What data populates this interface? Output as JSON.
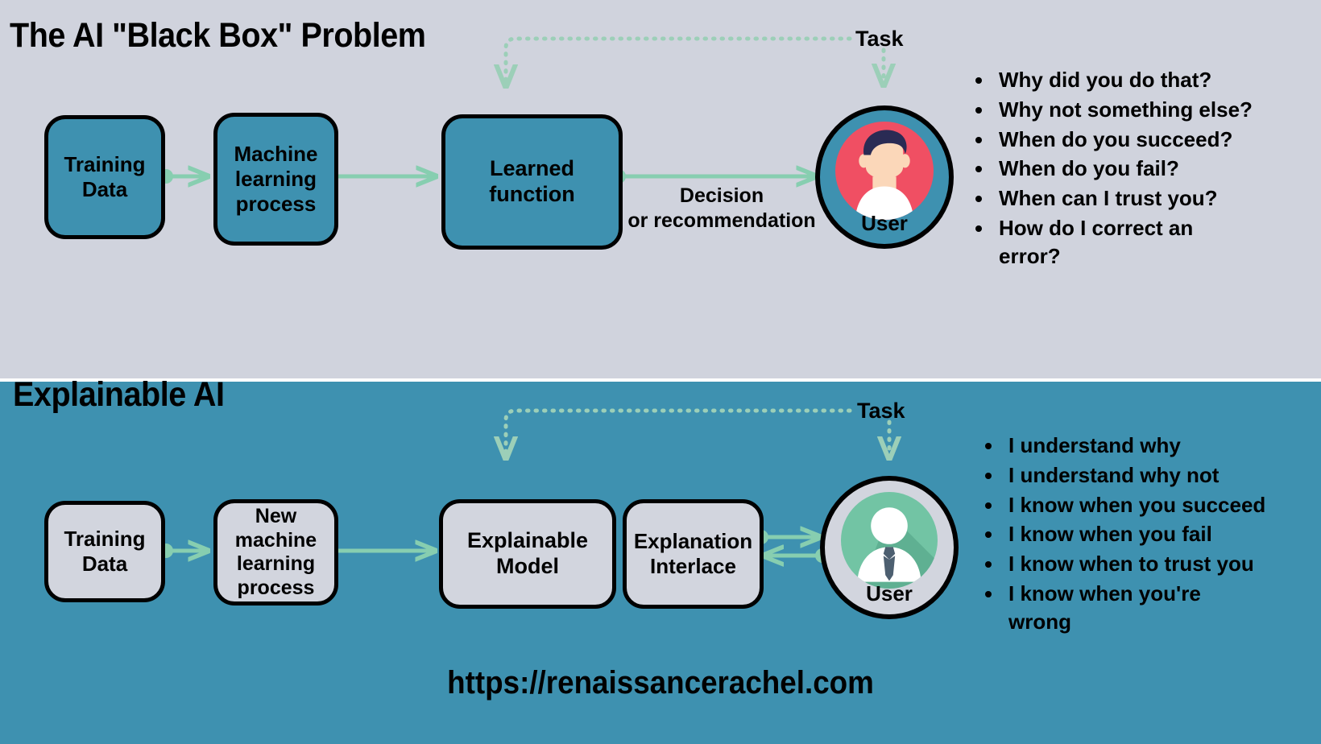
{
  "colors": {
    "top_panel_bg": "#d0d3dd",
    "bottom_panel_bg": "#3e91b0",
    "box_teal_fill": "#3e91b0",
    "box_gray_fill": "#d2d5de",
    "box_border": "#000000",
    "connector_green": "#87ceb0",
    "avatar_pink": "#f04f63",
    "avatar_hair_navy": "#2a2b54",
    "avatar_skin": "#fbd7b9",
    "avatar_green": "#72c4a4",
    "avatar_tie": "#4d5f70",
    "text": "#000000"
  },
  "top_panel": {
    "title": "The AI \"Black Box\" Problem",
    "task_label": "Task",
    "boxes": [
      {
        "id": "training-data",
        "label": "Training\nData"
      },
      {
        "id": "ml-process",
        "label": "Machine\nlearning\nprocess"
      },
      {
        "id": "learned-function",
        "label": "Learned\nfunction"
      }
    ],
    "decision_label": "Decision\nor recommendation",
    "user": {
      "label": "User",
      "avatar_icon": "user-avatar-pink-icon"
    },
    "bullets": [
      "Why did you do that?",
      "Why not something else?",
      "When do you succeed?",
      "When do you fail?",
      "When can I trust you?",
      "How do I correct an error?"
    ]
  },
  "bottom_panel": {
    "title": "Explainable AI",
    "task_label": "Task",
    "boxes": [
      {
        "id": "training-data",
        "label": "Training\nData"
      },
      {
        "id": "new-ml-process",
        "label": "New\nmachine\nlearning\nprocess"
      },
      {
        "id": "explainable-model",
        "label": "Explainable\nModel"
      },
      {
        "id": "explanation-interlace",
        "label": "Explanation\nInterlace"
      }
    ],
    "user": {
      "label": "User",
      "avatar_icon": "user-avatar-green-icon"
    },
    "bullets": [
      "I understand why",
      "I understand why not",
      "I know when you succeed",
      "I know when you fail",
      "I know when to trust you",
      "I know when you're wrong"
    ]
  },
  "footer": {
    "url": "https://renaissancerachel.com"
  }
}
